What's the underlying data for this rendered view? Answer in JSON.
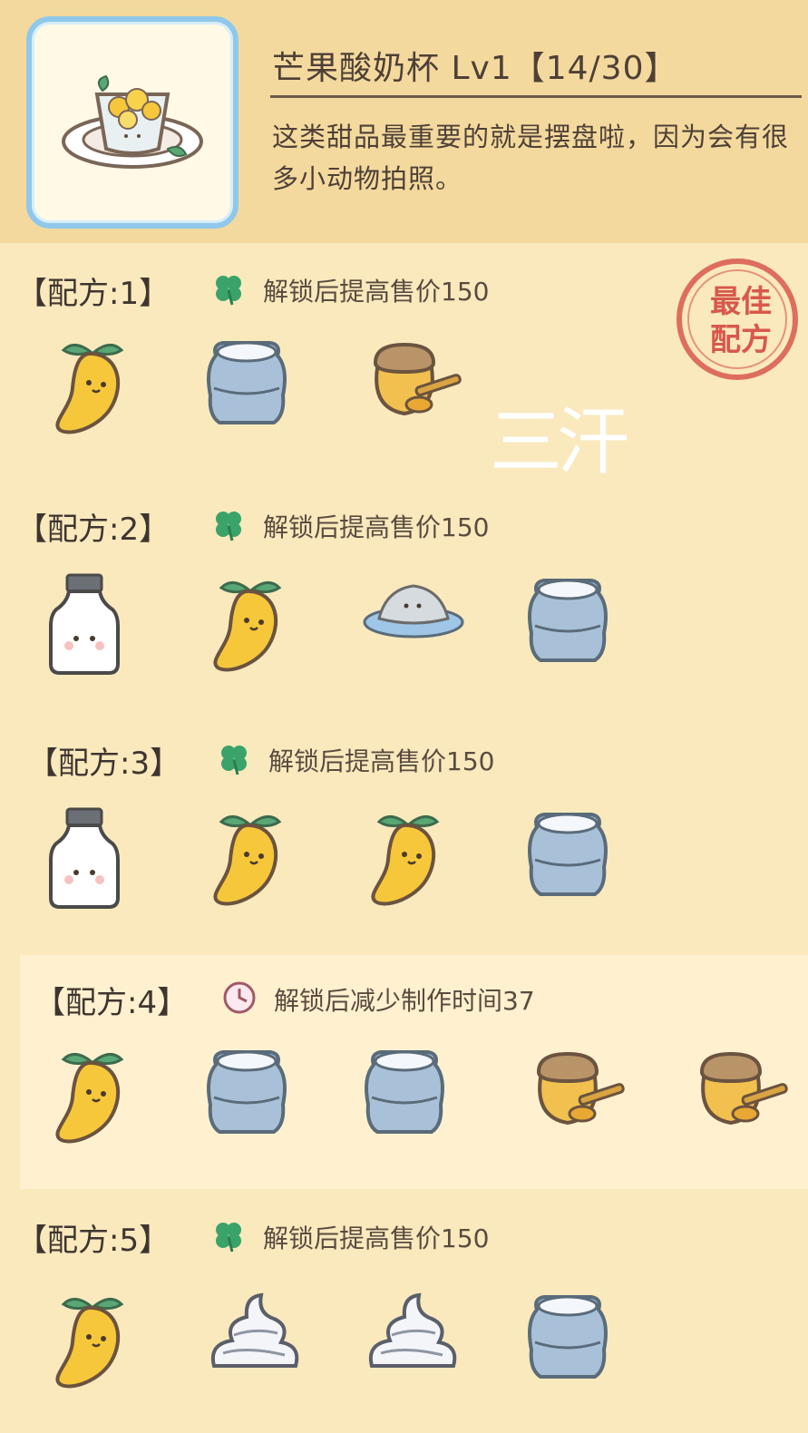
{
  "dessert": {
    "name": "芒果酸奶杯",
    "level": "Lv1",
    "progress": "【14/30】",
    "description": "这类甜品最重要的就是摆盘啦，因为会有很多小动物拍照。"
  },
  "stamp_text": [
    "最佳",
    "配方"
  ],
  "watermark": "三汗",
  "recipes": [
    {
      "label": "【配方:1】",
      "bonus_icon": "clover-icon",
      "bonus": "解锁后提高售价150",
      "ingredients": [
        "mango",
        "yogurt-jar",
        "honey-jar"
      ]
    },
    {
      "label": "【配方:2】",
      "bonus_icon": "clover-icon",
      "bonus": "解锁后提高售价150",
      "ingredients": [
        "milk-bottle",
        "mango",
        "grated-rice-plate",
        "yogurt-jar"
      ]
    },
    {
      "label": "【配方:3】",
      "bonus_icon": "clover-icon",
      "bonus": "解锁后提高售价150",
      "ingredients": [
        "milk-bottle",
        "mango",
        "mango",
        "yogurt-jar"
      ]
    },
    {
      "label": "【配方:4】",
      "bonus_icon": "clock-icon",
      "bonus": "解锁后减少制作时间37",
      "ingredients": [
        "mango",
        "yogurt-jar",
        "yogurt-jar",
        "honey-jar",
        "honey-jar"
      ]
    },
    {
      "label": "【配方:5】",
      "bonus_icon": "clover-icon",
      "bonus": "解锁后提高售价150",
      "ingredients": [
        "mango",
        "whipped-cream",
        "whipped-cream",
        "yogurt-jar"
      ]
    }
  ],
  "colors": {
    "background": "#f9e9bd",
    "header": "#f4d99e",
    "frame": "#8fc8ea",
    "clover": "#3aa36a",
    "stamp": "#d8584c"
  }
}
